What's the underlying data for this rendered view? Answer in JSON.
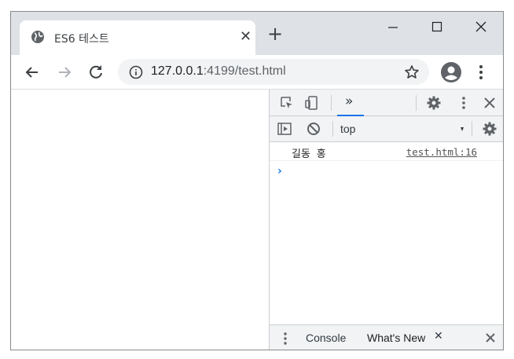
{
  "tab": {
    "title": "ES6 테스트",
    "close_glyph": "✕",
    "favicon": "globe-icon"
  },
  "newtab_glyph": "+",
  "toolbar": {
    "url_host": "127.0.0.1",
    "url_rest": ":4199/test.html"
  },
  "devtools": {
    "overflow_glyph": "»",
    "context": "top",
    "log": {
      "message": "길동 홍",
      "source": "test.html:16"
    },
    "prompt_glyph": "›",
    "drawer": {
      "console_label": "Console",
      "whatsnew_label": "What's New",
      "close_glyph": "✕"
    }
  },
  "colors": {
    "accent": "#1a73e8",
    "tabstrip": "#dee1e6",
    "panel": "#f1f3f4"
  }
}
